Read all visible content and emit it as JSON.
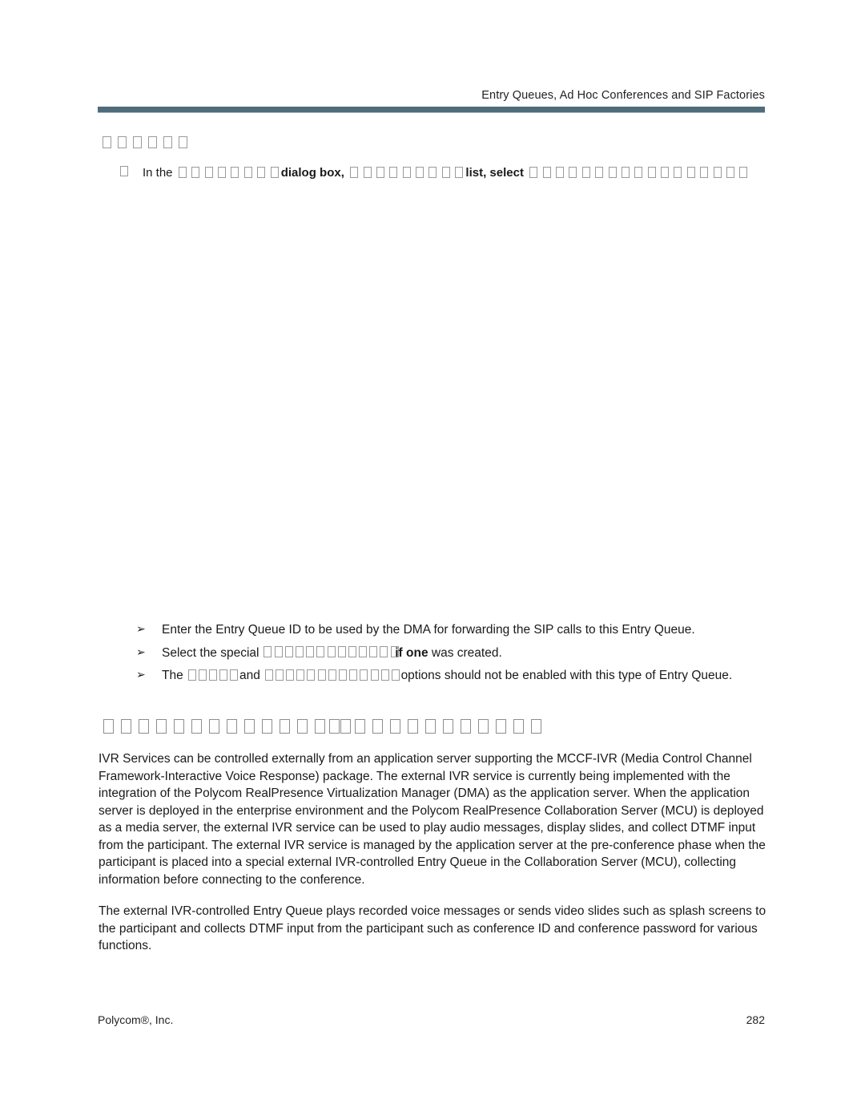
{
  "header": {
    "running_title": "Entry Queues, Ad Hoc Conferences and SIP Factories",
    "rule_color": "#4f6c7b"
  },
  "sub_heading": {
    "tofu_count": 6
  },
  "procedure": {
    "marker": "tofu-box",
    "segments": [
      {
        "type": "text",
        "value": "In the"
      },
      {
        "type": "tofu",
        "count": 8
      },
      {
        "type": "bold",
        "value": "dialog box,"
      },
      {
        "type": "tofu",
        "count": 9
      },
      {
        "type": "bold",
        "value": "list, select"
      },
      {
        "type": "tofu",
        "count": 17
      }
    ]
  },
  "arrow_list": {
    "marker": "➢",
    "items": [
      {
        "segments": [
          {
            "type": "text",
            "value": "Enter the Entry Queue ID to be used by the DMA for forwarding the SIP calls to this Entry Queue."
          }
        ]
      },
      {
        "segments": [
          {
            "type": "text",
            "value": "Select the special"
          },
          {
            "type": "tofu",
            "count": 13
          },
          {
            "type": "overlap",
            "value": "if one"
          },
          {
            "type": "text",
            "value": "was created."
          }
        ]
      },
      {
        "segments": [
          {
            "type": "text",
            "value": "The"
          },
          {
            "type": "tofu",
            "count": 5
          },
          {
            "type": "text",
            "value": "and"
          },
          {
            "type": "tofu",
            "count": 13
          },
          {
            "type": "text",
            "value": "options should not be enabled with this type of Entry Queue."
          }
        ]
      }
    ]
  },
  "section_heading": {
    "tofu_groups": [
      13,
      2,
      11
    ]
  },
  "body": {
    "paragraphs": [
      "IVR Services can be controlled externally from an application server supporting the MCCF-IVR (Media Control Channel Framework-Interactive Voice Response) package. The external IVR service is currently being implemented with the integration of the Polycom RealPresence Virtualization Manager (DMA) as the application server. When the application server is deployed in the enterprise environment and the Polycom RealPresence Collaboration Server (MCU) is deployed as a media server, the external IVR service can be used to play audio messages, display slides, and collect DTMF input from the participant. The external IVR service is managed by the application server at the pre-conference phase when the participant is placed into a special external IVR-controlled Entry Queue in the Collaboration Server (MCU), collecting information before connecting to the conference.",
      "The external IVR-controlled Entry Queue plays recorded voice messages or sends video slides such as splash screens to the participant and collects DTMF input from the participant such as conference ID and conference password for various functions."
    ]
  },
  "footer": {
    "company": "Polycom®, Inc.",
    "page_number": "282"
  }
}
